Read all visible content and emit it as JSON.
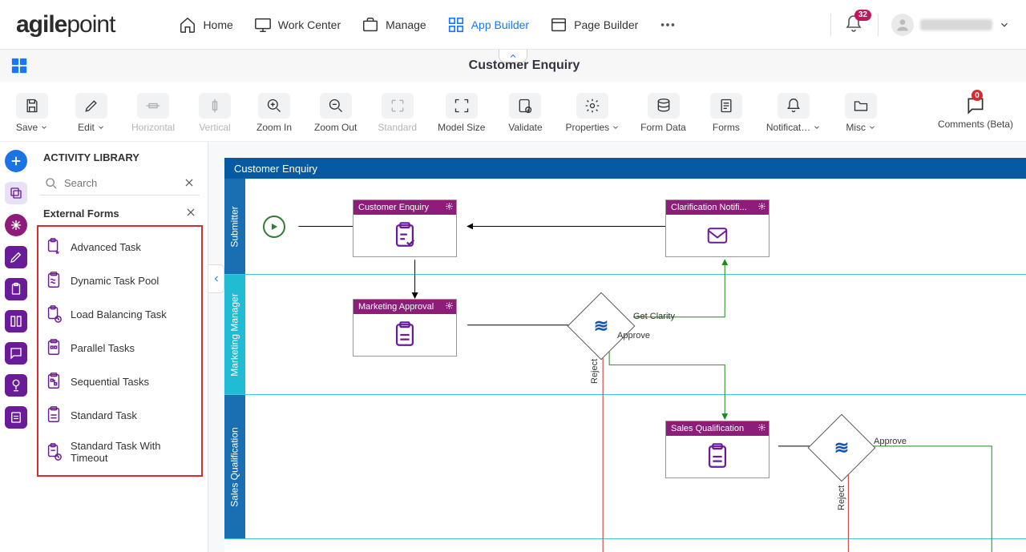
{
  "brand": {
    "name1": "agile",
    "name2": "point"
  },
  "nav": {
    "home": "Home",
    "work": "Work Center",
    "manage": "Manage",
    "appb": "App Builder",
    "pageb": "Page Builder",
    "notif_count": "32"
  },
  "appTitle": "Customer Enquiry",
  "toolbar": {
    "save": "Save",
    "edit": "Edit",
    "horiz": "Horizontal",
    "vert": "Vertical",
    "zin": "Zoom In",
    "zout": "Zoom Out",
    "std": "Standard",
    "msize": "Model Size",
    "validate": "Validate",
    "props": "Properties",
    "fdata": "Form Data",
    "forms": "Forms",
    "notif": "Notificat…",
    "misc": "Misc",
    "comments": "Comments (Beta)",
    "comments_count": "0"
  },
  "library": {
    "title": "ACTIVITY LIBRARY",
    "search_placeholder": "Search",
    "category": "External Forms",
    "items": [
      "Advanced Task",
      "Dynamic Task Pool",
      "Load Balancing Task",
      "Parallel Tasks",
      "Sequential Tasks",
      "Standard Task",
      "Standard Task With Timeout"
    ]
  },
  "pool": {
    "title": "Customer Enquiry"
  },
  "lanes": {
    "l1": "Submitter",
    "l2": "Marketing Manager",
    "l3": "Sales Qualification"
  },
  "nodes": {
    "n1": "Customer Enquiry",
    "n2": "Clarification Notifi...",
    "n3": "Marketing Approval",
    "n4": "Sales Qualification"
  },
  "edges": {
    "getClarity": "Get Clarity",
    "approve": "Approve",
    "reject": "Reject",
    "approve2": "Approve",
    "reject2": "Reject"
  }
}
